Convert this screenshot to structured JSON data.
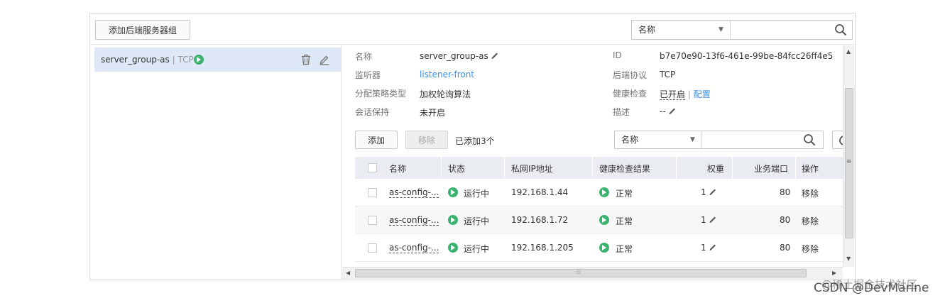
{
  "toolbar": {
    "add_group_label": "添加后端服务器组",
    "search_field": "名称"
  },
  "group": {
    "name": "server_group-as",
    "separator": " | ",
    "protocol": "TCP"
  },
  "detail": {
    "name_label": "名称",
    "name_value": "server_group-as",
    "listener_label": "监听器",
    "listener_value": "listener-front",
    "policy_label": "分配策略类型",
    "policy_value": "加权轮询算法",
    "session_label": "会话保持",
    "session_value": "未开启",
    "id_label": "ID",
    "id_value": "b7e70e90-13f6-461e-99be-84fcc26ff4e5",
    "protocol_label": "后端协议",
    "protocol_value": "TCP",
    "health_label": "健康检查",
    "health_value": "已开启",
    "health_sep": " | ",
    "health_config": "配置",
    "desc_label": "描述",
    "desc_value": "--"
  },
  "members": {
    "add_label": "添加",
    "remove_label": "移除",
    "added_count": "已添加3个",
    "search_field": "名称",
    "columns": [
      "名称",
      "状态",
      "私网IP地址",
      "健康检查结果",
      "权重",
      "业务端口",
      "操作"
    ],
    "rows": [
      {
        "name": "as-config-...",
        "status": "运行中",
        "ip": "192.168.1.44",
        "health": "正常",
        "weight": "1",
        "port": "80",
        "action": "移除"
      },
      {
        "name": "as-config-...",
        "status": "运行中",
        "ip": "192.168.1.72",
        "health": "正常",
        "weight": "1",
        "port": "80",
        "action": "移除"
      },
      {
        "name": "as-config-...",
        "status": "运行中",
        "ip": "192.168.1.205",
        "health": "正常",
        "weight": "1",
        "port": "80",
        "action": "移除"
      }
    ]
  },
  "watermark": {
    "line1": "@稀土掘金技术社区",
    "line2": "CSDN @DevMarine"
  },
  "colors": {
    "accent": "#3a8ee6",
    "selected_row": "#dfe8f6",
    "status_green": "#3cb371"
  }
}
